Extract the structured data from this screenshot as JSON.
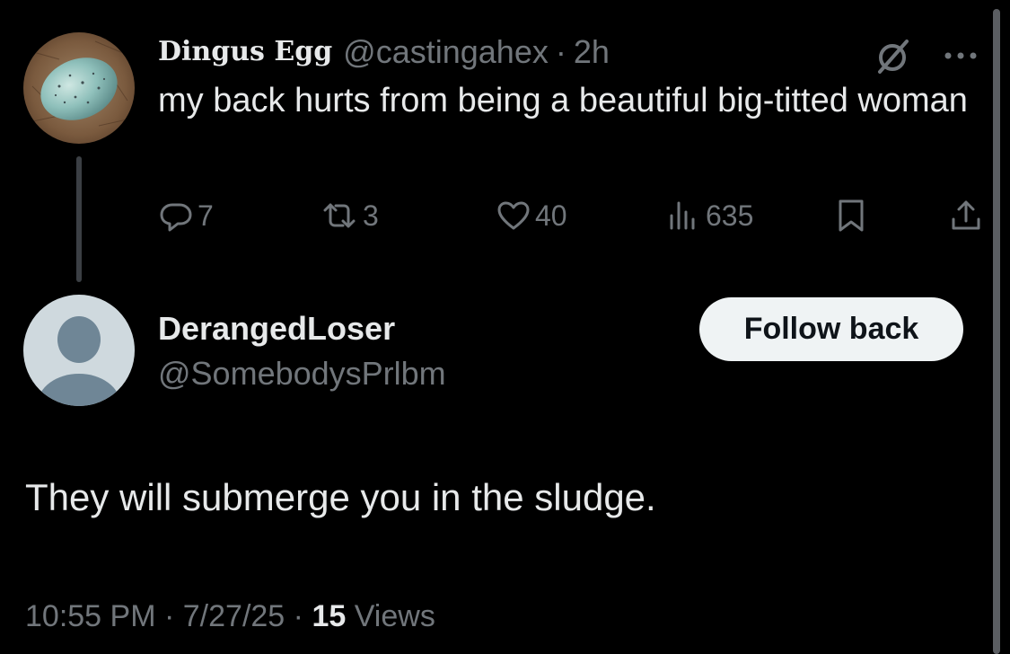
{
  "colors": {
    "background": "#000000",
    "text_primary": "#e7e9ea",
    "text_secondary": "#71767b",
    "button_bg": "#eff3f4",
    "button_text": "#0f1419",
    "thread_line": "#3b3f44"
  },
  "parent_tweet": {
    "display_name": "Dingus Egg",
    "handle": "@castingahex",
    "separator": "·",
    "age": "2h",
    "text": "my back hurts from being a beautiful big-titted woman",
    "avatar_icon": "egg-avatar",
    "header_icons": [
      "grok-icon",
      "more-icon"
    ],
    "actions": {
      "replies": "7",
      "reposts": "3",
      "likes": "40",
      "views": "635"
    }
  },
  "reply": {
    "display_name": "DerangedLoser",
    "handle": "@SomebodysPrlbm",
    "follow_button_label": "Follow back",
    "text": "They will submerge you in the sludge.",
    "avatar_icon": "default-avatar",
    "meta": {
      "time": "10:55 PM",
      "separator1": "·",
      "date": "7/27/25",
      "separator2": "·",
      "views_count": "15",
      "views_label": "Views"
    }
  }
}
